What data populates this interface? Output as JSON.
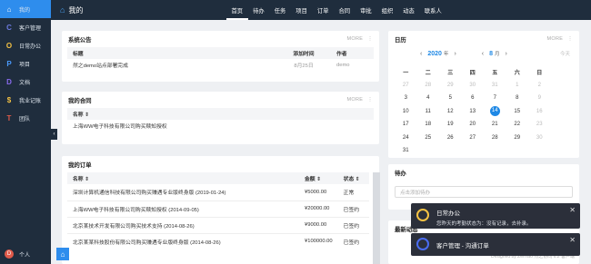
{
  "sidebar": {
    "items": [
      {
        "label": "我的",
        "icon": "home-icon",
        "glyph": "⌂"
      },
      {
        "label": "客户管理",
        "icon": "customer-icon",
        "glyph": "C"
      },
      {
        "label": "日常办公",
        "icon": "office-icon",
        "glyph": "O"
      },
      {
        "label": "项目",
        "icon": "project-icon",
        "glyph": "P"
      },
      {
        "label": "文档",
        "icon": "document-icon",
        "glyph": "D"
      },
      {
        "label": "我业记账",
        "icon": "accounting-icon",
        "glyph": "$"
      },
      {
        "label": "团队",
        "icon": "team-icon",
        "glyph": "T"
      }
    ],
    "user": {
      "avatar": "D",
      "label": "个人"
    }
  },
  "topbar": {
    "title": "我的",
    "nav": [
      "首页",
      "待办",
      "任务",
      "项目",
      "订单",
      "合同",
      "审批",
      "组织",
      "动态",
      "联系人"
    ]
  },
  "announcements": {
    "title": "系统公告",
    "more": "MORE",
    "columns": [
      "标题",
      "添加时间",
      "作者"
    ],
    "rows": [
      {
        "title": "然之demo站点部署完成",
        "date": "8月25日",
        "author": "demo"
      }
    ]
  },
  "contracts": {
    "title": "我的合同",
    "more": "MORE",
    "column": "名称",
    "rows": [
      "上海WW电子科技有限公司购买赎知授权"
    ]
  },
  "orders": {
    "title": "我的订单",
    "columns": [
      "名称",
      "金额",
      "状态"
    ],
    "rows": [
      {
        "name": "深圳计算机通信科技有限公司购买赚遇专业版终身版 (2019-01-24)",
        "amount": "¥5000.00",
        "status": "正常"
      },
      {
        "name": "上海WW电子科技有限公司购买赎知授权 (2014-09-05)",
        "amount": "¥20000.00",
        "status": "已签约"
      },
      {
        "name": "北京某技术开发有限公司购买技术支持 (2014-08-26)",
        "amount": "¥9000.00",
        "status": "已签约"
      },
      {
        "name": "北京某某科技股份有限公司购买赚遇专业版终身版 (2014-08-26)",
        "amount": "¥100000.00",
        "status": "已签约"
      }
    ]
  },
  "calendar": {
    "title": "日历",
    "more": "MORE",
    "year": "2020",
    "year_unit": "年",
    "month": "8",
    "month_unit": "月",
    "today_label": "今天",
    "weekdays": [
      "一",
      "二",
      "三",
      "四",
      "五",
      "六",
      "日"
    ],
    "weeks": [
      [
        "27",
        "28",
        "29",
        "30",
        "31",
        "1",
        "2"
      ],
      [
        "3",
        "4",
        "5",
        "6",
        "7",
        "8",
        "9"
      ],
      [
        "10",
        "11",
        "12",
        "13",
        "14",
        "15",
        "16"
      ],
      [
        "17",
        "18",
        "19",
        "20",
        "21",
        "22",
        "23"
      ],
      [
        "24",
        "25",
        "26",
        "27",
        "28",
        "29",
        "30"
      ],
      [
        "31",
        "",
        "",
        "",
        "",
        "",
        ""
      ]
    ],
    "today": "14"
  },
  "todo": {
    "title": "待办",
    "placeholder": "点击添加待办"
  },
  "latest": {
    "title": "最新动态"
  },
  "notifications": [
    {
      "title": "日常办公",
      "body": "您昨天的考勤状态为：没有记录，去补录。",
      "icon_color": "#f6c344"
    },
    {
      "title": "客户管理 - 沟通订单",
      "body": "",
      "icon_color": "#4a6cf0"
    }
  ],
  "footer": {
    "text": "Designed by ZenTao 然之协同 6.2  客户端"
  }
}
